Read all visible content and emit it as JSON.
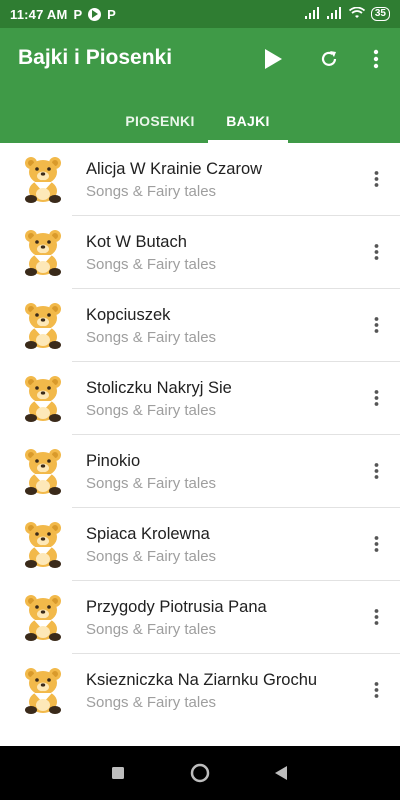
{
  "status_bar": {
    "time": "11:47 AM",
    "app_icons": [
      "P",
      "play",
      "P"
    ],
    "battery": "35",
    "icons": [
      "signal-icon",
      "signal-icon",
      "wifi-icon",
      "battery-icon"
    ]
  },
  "app_bar": {
    "title": "Bajki i Piosenki",
    "actions": [
      "play-icon",
      "refresh-icon",
      "more-vert-icon"
    ],
    "tabs": [
      {
        "label": "PIOSENKI",
        "active": false
      },
      {
        "label": "BAJKI",
        "active": true
      }
    ]
  },
  "list": {
    "items": [
      {
        "title": "Alicja W Krainie Czarow",
        "subtitle": "Songs & Fairy tales"
      },
      {
        "title": "Kot W Butach",
        "subtitle": "Songs & Fairy tales"
      },
      {
        "title": "Kopciuszek",
        "subtitle": "Songs & Fairy tales"
      },
      {
        "title": "Stoliczku Nakryj Sie",
        "subtitle": "Songs & Fairy tales"
      },
      {
        "title": "Pinokio",
        "subtitle": "Songs & Fairy tales"
      },
      {
        "title": "Spiaca Krolewna",
        "subtitle": "Songs & Fairy tales"
      },
      {
        "title": "Przygody Piotrusia Pana",
        "subtitle": "Songs & Fairy tales"
      },
      {
        "title": "Ksiezniczka Na Ziarnku Grochu",
        "subtitle": "Songs & Fairy tales"
      }
    ]
  },
  "colors": {
    "status_bar": "#2f7d32",
    "app_bar": "#3f9a47",
    "bear": "#f2b94a"
  }
}
